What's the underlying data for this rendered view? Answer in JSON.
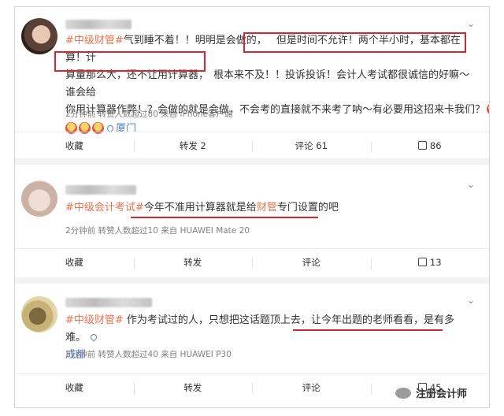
{
  "posts": [
    {
      "text_parts": [
        "#中级财管#",
        " 气到睡不着！！明明是会做的，",
        "但是时间不允许！两个半小时，基本都在算！计算量那么大，还不让用计算器，",
        "根本来不及！！投诉投诉！会计人考试都很诚信的好嘛～谁会给你用计算器作弊！？会做的就是会做，不会考的直接就不来考了呐～有必要用这招来卡我们？"
      ],
      "line1": "气到睡不着！！明明是会做的",
      "line1b": "，",
      "boxed1": "但是时间不允许！两个半小时，基本都在算！计",
      "boxed2": "算量那么大，还不让用计算器，",
      "line2rest": "根本来不及！！投诉投诉！会计人考试都很诚信的好嘛～谁会给",
      "line3": "你用计算器作弊！？会做的就是会做，不会考的直接就不来考了呐～有必要用这招来卡我们？",
      "tag": "#中级财管#",
      "location": "厦门",
      "meta": "2分钟前 转赞人数超过80 来自 iPhone客户端",
      "actions": {
        "collect": "收藏",
        "repost": "转发 2",
        "comment": "评论 61",
        "like": "86"
      }
    },
    {
      "tag": "#中级会计考试#",
      "text": "今年不准用计算器就是给",
      "text_tag": "财管",
      "text_end": "专门设置的吧",
      "meta": "2分钟前 转赞人数超过10 来自 HUAWEI Mate 20",
      "actions": {
        "collect": "收藏",
        "repost": "转发",
        "comment": "评论",
        "like": "13"
      }
    },
    {
      "tag": "#中级财管#",
      "text1": " 作为考试过的人，只想把这话题顶上去，",
      "text2": "让今年出题的老师看看，是有多难。",
      "location": "成都",
      "meta": "2分钟前 转赞人数超过40 来自 HUAWEI P30",
      "actions": {
        "collect": "收藏",
        "repost": "转发",
        "comment": "评论",
        "like": "45"
      }
    }
  ],
  "watermark": "注册会计师",
  "colors": {
    "tag": "#eb7350",
    "highlight": "#d9262c",
    "link": "#5b82c7"
  }
}
